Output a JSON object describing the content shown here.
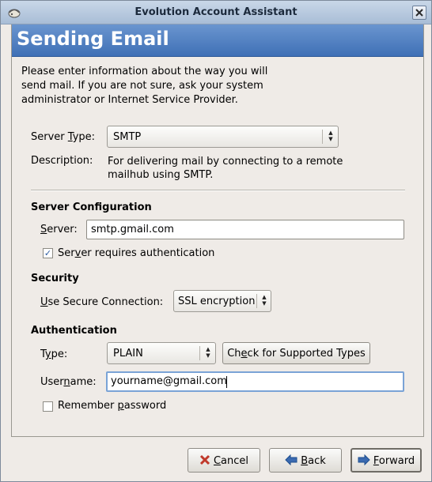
{
  "window": {
    "title": "Evolution Account Assistant",
    "close_label": "x",
    "title_icon": "evolution-app-icon"
  },
  "page": {
    "heading": "Sending Email",
    "intro": "Please enter information about the way you will send mail. If you are not sure, ask your system administrator or Internet Service Provider."
  },
  "server_type": {
    "label": "Server Type:",
    "value": "SMTP",
    "description_label": "Description:",
    "description": "For delivering mail by connecting to a remote mailhub using SMTP."
  },
  "server_config": {
    "heading": "Server Configuration",
    "server_label": "Server:",
    "server_value": "smtp.gmail.com",
    "requires_auth_label": "Server requires authentication",
    "requires_auth_checked": true
  },
  "security": {
    "heading": "Security",
    "secure_label": "Use Secure Connection:",
    "secure_value": "SSL encryption"
  },
  "authentication": {
    "heading": "Authentication",
    "type_label": "Type:",
    "type_value": "PLAIN",
    "check_button": "Check for Supported Types",
    "username_label": "Username:",
    "username_value": "yourname@gmail.com",
    "remember_label": "Remember password",
    "remember_checked": false
  },
  "buttons": {
    "cancel": "Cancel",
    "back": "Back",
    "forward": "Forward"
  },
  "colors": {
    "header_blue": "#4a7cc0",
    "cancel_icon": "#c0392b",
    "nav_icon": "#1e4f8f"
  }
}
